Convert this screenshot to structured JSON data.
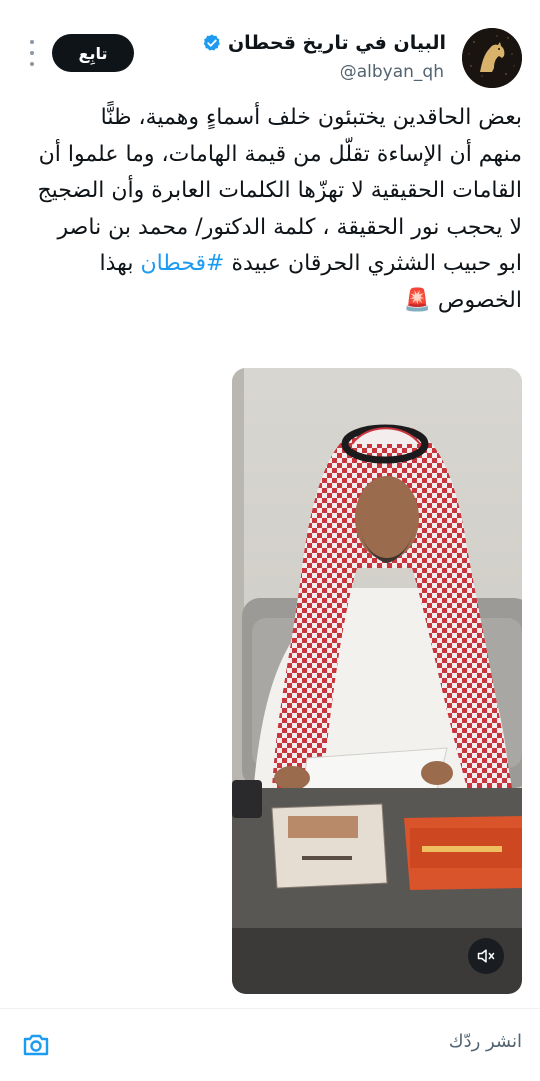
{
  "tweet": {
    "author_name": "البيان في تاريخ قحطان",
    "author_handle": "@albyan_qh",
    "follow_label": "تابِع",
    "text_line1": "بعض الحاقدين يختبئون خلف أسماءٍ وهمية، ظنًّا",
    "text_line2": "منهم أن الإساءة تقلّل من قيمة الهامات، وما علموا أن",
    "text_line3": "القامات الحقيقية لا تهزّها الكلمات العابرة وأن الضجيج",
    "text_line4": "لا يحجب نور الحقيقة ، كلمة الدكتور/ محمد بن ناصر",
    "text_line5_pre": "ابو حبيب الشثري الحرقان عبيدة ",
    "hashtag": "#قحطان",
    "text_line5_post": " بهذا",
    "text_line6": "الخصوص 🚨"
  },
  "reply_bar": {
    "placeholder": "انشر ردّك"
  },
  "icons": {
    "more": "more-dots-icon",
    "verified": "verified-badge-icon",
    "mute": "mute-icon",
    "camera": "camera-icon",
    "siren": "siren-emoji"
  },
  "colors": {
    "accent": "#1d9bf0",
    "text": "#0f1419",
    "secondary": "#536471",
    "follow_bg": "#0f1419"
  }
}
